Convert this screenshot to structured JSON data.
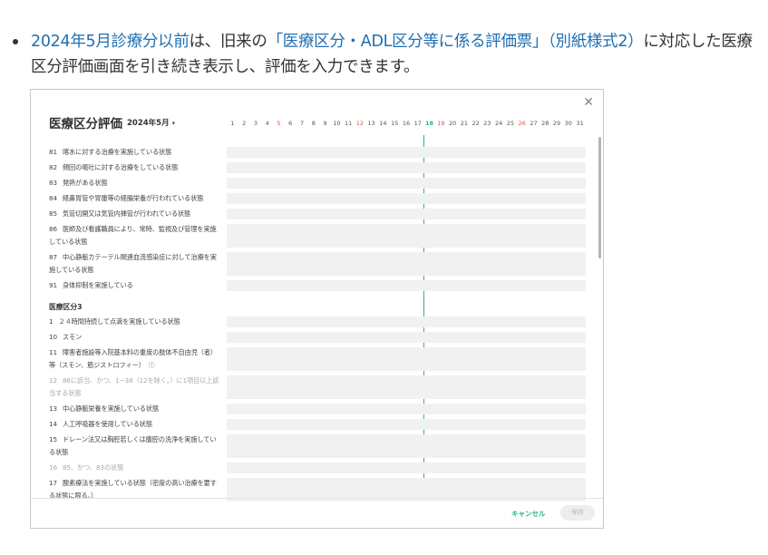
{
  "intro": {
    "lead": "2024年5月診療分以前",
    "mid": "は、旧来の",
    "link": "「医療区分・ADL区分等に係る評価票」（別紙様式2）",
    "tail": "に対応した医療区分評価画面を引き続き表示し、評価を入力できます。"
  },
  "modal": {
    "title": "医療区分評価",
    "month": "2024年5月",
    "close_icon": "close-icon",
    "days": [
      "1",
      "2",
      "3",
      "4",
      "5",
      "6",
      "7",
      "8",
      "9",
      "10",
      "11",
      "12",
      "13",
      "14",
      "15",
      "16",
      "17",
      "18",
      "19",
      "20",
      "21",
      "22",
      "23",
      "24",
      "25",
      "26",
      "27",
      "28",
      "29",
      "30",
      "31"
    ],
    "sunday_days": [
      "5",
      "12",
      "19",
      "26"
    ],
    "today_day": "18",
    "items_a": [
      {
        "no": "81",
        "text": "喀水に対する治療を実施している状態"
      },
      {
        "no": "82",
        "text": "頻回の嘔吐に対する治療をしている状態"
      },
      {
        "no": "83",
        "text": "発熱がある状態"
      },
      {
        "no": "84",
        "text": "経鼻胃管や胃瘻等の経腸栄養が行われている状態"
      },
      {
        "no": "85",
        "text": "気管切開又は気管内挿管が行われている状態"
      },
      {
        "no": "86",
        "text": "医師及び看護職員により、常時、監視及び管理を実施している状態"
      },
      {
        "no": "87",
        "text": "中心静脈カテーテル関連血流感染症に対して治療を実施している状態"
      },
      {
        "no": "91",
        "text": "身体抑制を実施している"
      }
    ],
    "section_title": "医療区分3",
    "items_b": [
      {
        "no": "1",
        "text": "２４時間持続して点滴を実施している状態"
      },
      {
        "no": "10",
        "text": "スモン"
      },
      {
        "no": "11",
        "text": "障害者施設等入院基本料の重度の肢体不自由児（者）等（スモン、筋ジストロフィー）",
        "info": "ⓘ"
      },
      {
        "no": "12",
        "text": "86に該当、かつ、1~38（12を除く。）に1項目以上該当する状態"
      },
      {
        "no": "13",
        "text": "中心静脈栄養を実施している状態"
      },
      {
        "no": "14",
        "text": "人工呼吸器を使用している状態"
      },
      {
        "no": "15",
        "text": "ドレーン法又は胸腔若しくは腹腔の洗浄を実施している状態"
      },
      {
        "no": "16",
        "text": "85、かつ、83の状態"
      },
      {
        "no": "17",
        "text": "酸素療法を実施している状態（密度の高い治療を要する状態に限る。）"
      }
    ],
    "cancel_label": "キャンセル",
    "save_label": "保存"
  }
}
